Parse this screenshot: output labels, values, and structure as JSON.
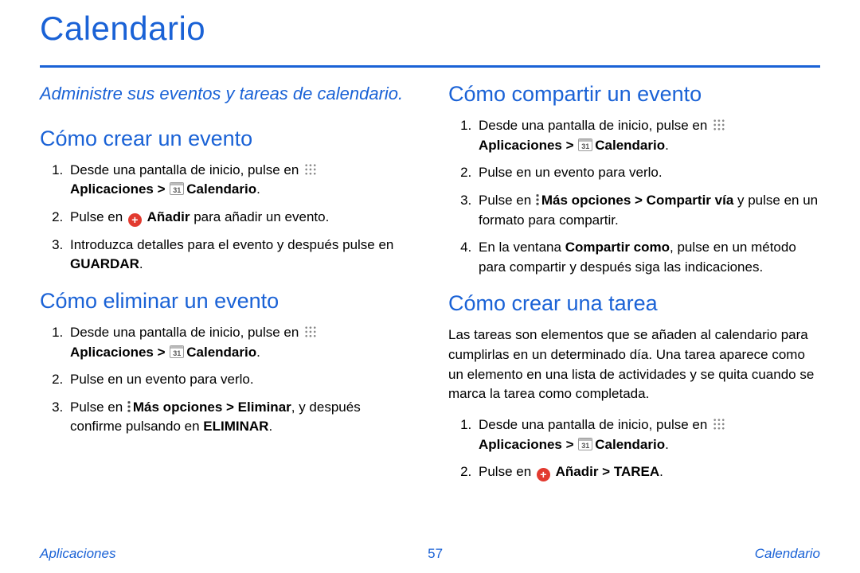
{
  "title": "Calendario",
  "subtitle": "Administre sus eventos y tareas de calendario.",
  "left": {
    "s1": {
      "heading": "Cómo crear un evento",
      "step1_a": "Desde una pantalla de inicio, pulse en ",
      "step1_b": "Aplicaciones > ",
      "step1_c": "Calendario",
      "step1_d": ".",
      "step2_a": "Pulse en ",
      "step2_b": "Añadir",
      "step2_c": " para añadir un evento.",
      "step3_a": "Introduzca detalles para el evento y después pulse en ",
      "step3_b": "GUARDAR",
      "step3_c": "."
    },
    "s2": {
      "heading": "Cómo eliminar un evento",
      "step1_a": "Desde una pantalla de inicio, pulse en ",
      "step1_b": "Aplicaciones > ",
      "step1_c": "Calendario",
      "step1_d": ".",
      "step2": "Pulse en un evento para verlo.",
      "step3_a": "Pulse en ",
      "step3_b": "Más opciones > Eliminar",
      "step3_c": ", y después confirme pulsando en ",
      "step3_d": "ELIMINAR",
      "step3_e": "."
    }
  },
  "right": {
    "s1": {
      "heading": "Cómo compartir un evento",
      "step1_a": "Desde una pantalla de inicio, pulse en ",
      "step1_b": "Aplicaciones > ",
      "step1_c": "Calendario",
      "step1_d": ".",
      "step2": "Pulse en un evento para verlo.",
      "step3_a": "Pulse en ",
      "step3_b": "Más opciones > Compartir vía",
      "step3_c": " y pulse en un formato para compartir.",
      "step4_a": "En la ventana ",
      "step4_b": "Compartir como",
      "step4_c": ", pulse en un método para compartir y después siga las indicaciones."
    },
    "s2": {
      "heading": "Cómo crear una tarea",
      "intro": "Las tareas son elementos que se añaden al calendario para cumplirlas en un determinado día. Una tarea aparece como un elemento en una lista de actividades y se quita cuando se marca la tarea como completada.",
      "step1_a": "Desde una pantalla de inicio, pulse en ",
      "step1_b": "Aplicaciones > ",
      "step1_c": "Calendario",
      "step1_d": ".",
      "step2_a": "Pulse en ",
      "step2_b": "Añadir > TAREA",
      "step2_c": "."
    }
  },
  "footer": {
    "left": "Aplicaciones",
    "page": "57",
    "right": "Calendario"
  },
  "icons": {
    "cal_day": "31"
  }
}
